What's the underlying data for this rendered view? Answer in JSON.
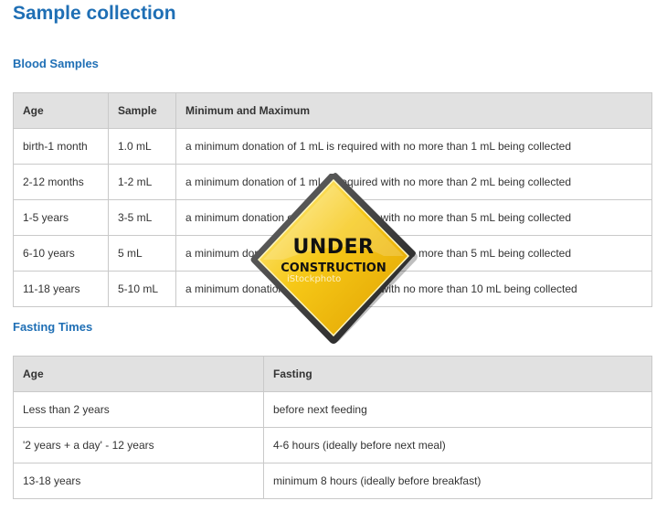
{
  "page": {
    "title": "Sample collection"
  },
  "blood": {
    "heading": "Blood Samples",
    "headers": [
      "Age",
      "Sample",
      "Minimum and Maximum"
    ],
    "rows": [
      [
        "birth-1 month",
        "1.0 mL",
        "a minimum donation of 1 mL is required with no more than 1 mL being collected"
      ],
      [
        "2-12 months",
        "1-2 mL",
        "a minimum donation of 1 mL is required with no more than 2 mL being collected"
      ],
      [
        "1-5 years",
        "3-5 mL",
        "a minimum donation of 1 mL is required with no more than 5 mL being collected"
      ],
      [
        "6-10 years",
        "5 mL",
        "a minimum donation of 1 mL is required with no more than 5 mL being collected"
      ],
      [
        "11-18 years",
        "5-10 mL",
        "a minimum donation of 1 mL is required with no more than 10 mL being collected"
      ]
    ]
  },
  "fasting": {
    "heading": "Fasting Times",
    "headers": [
      "Age",
      "Fasting"
    ],
    "rows": [
      [
        "Less than 2 years",
        "before next feeding"
      ],
      [
        "'2 years + a day' - 12 years",
        "4-6 hours (ideally before next meal)"
      ],
      [
        "13-18 years",
        "minimum 8 hours (ideally before breakfast)"
      ]
    ]
  },
  "sign": {
    "line1": "UNDER",
    "line2": "CONSTRUCTION",
    "watermark": "iStockphoto",
    "fill_color": "#f6c817",
    "border_color": "#2b2b2b"
  },
  "colors": {
    "heading": "#1f6fb5",
    "table_header_bg": "#e1e1e1",
    "table_border": "#c9c9c9"
  }
}
